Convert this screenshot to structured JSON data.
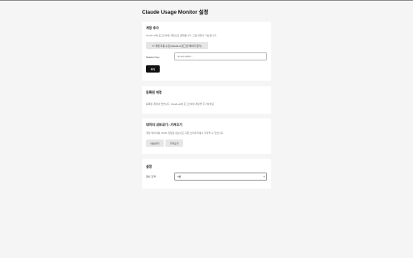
{
  "page": {
    "title": "Claude Usage Monitor 설정"
  },
  "add_account": {
    "title": "계정 추가",
    "description": "claude.ai에 로그인하면 계정으로 결제됩니다. 그림 해당이 가능합니다.",
    "auto_button_label": "↻ 계정 자동 수집 (claude.ai 로그인 페이지 열기)",
    "session_key_label": "Session Key",
    "session_key_placeholder": "sk-ant-sid01-...",
    "add_button_label": "추가"
  },
  "registered_accounts": {
    "title": "등록된 계정",
    "description": "등록된 계정이 없습니다. claude.ai에 로그인하여 계정을 추가하세요."
  },
  "data_io": {
    "title": "데이터 내보내기 / 가져오기",
    "description": "계정 데이터를 JSON 파일로 내보내고 다른 브라우저에서 가져올 수 있습니다.",
    "export_label": "내보내기",
    "import_label": "가져오기"
  },
  "settings": {
    "title": "설정",
    "interval_label": "갱신 간격",
    "interval_value": "5분"
  }
}
